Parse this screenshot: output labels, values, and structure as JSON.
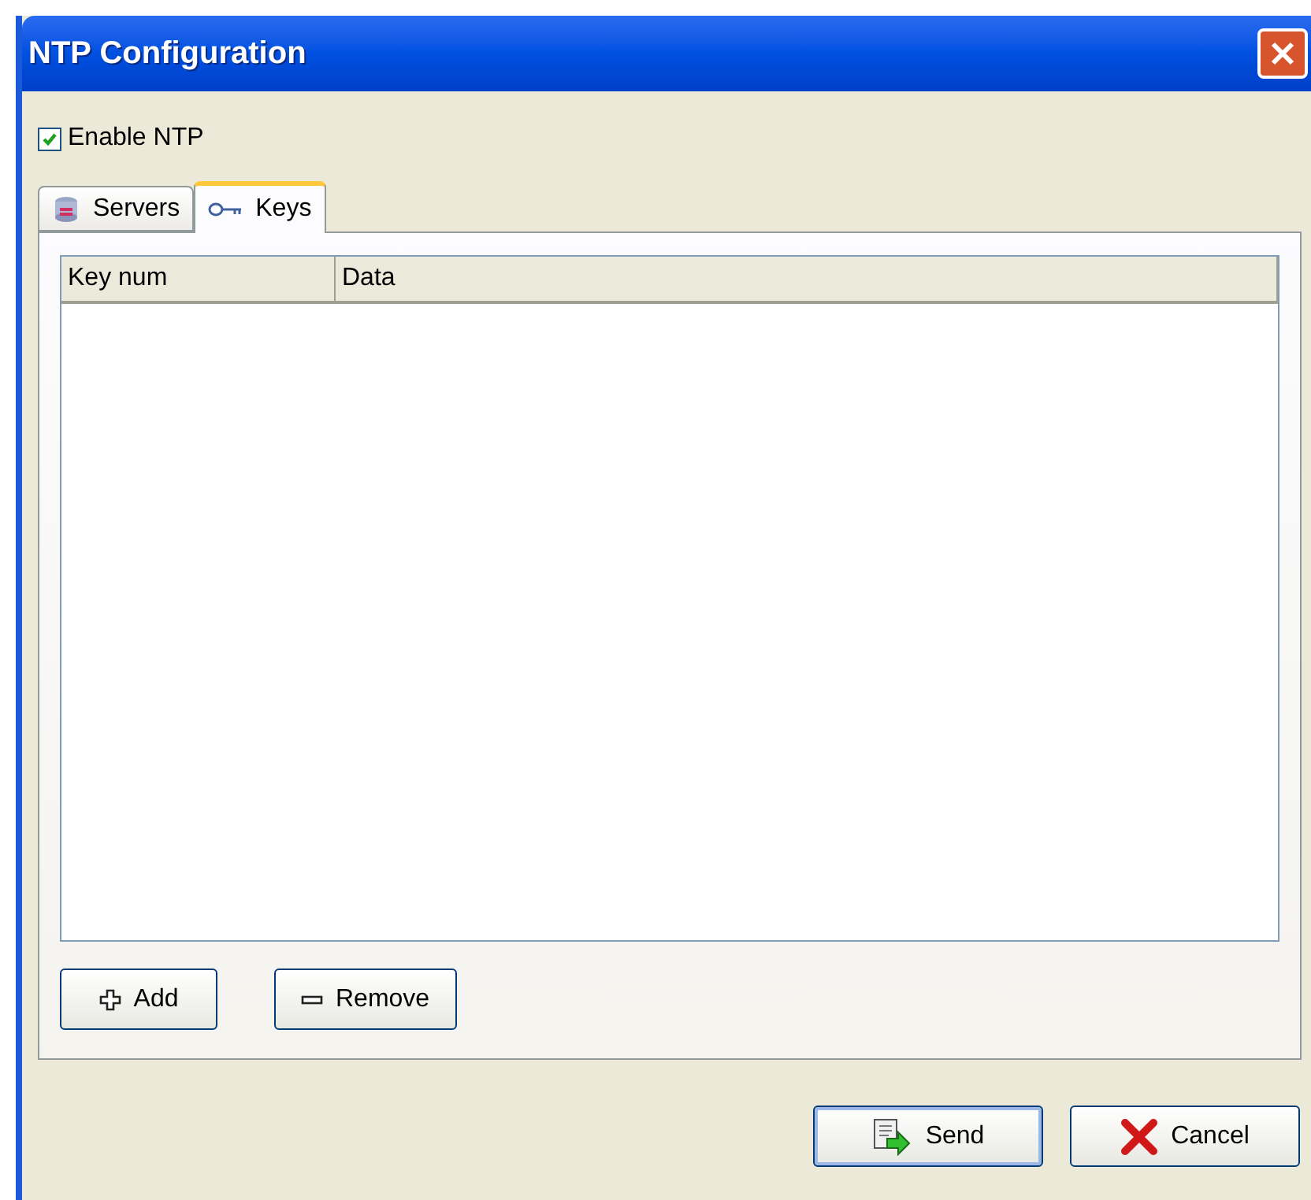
{
  "window": {
    "title": "NTP Configuration"
  },
  "enable": {
    "label": "Enable NTP",
    "checked": true
  },
  "tabs": [
    {
      "label": "Servers",
      "kind": "servers",
      "selected": false
    },
    {
      "label": "Keys",
      "kind": "keys",
      "selected": true
    }
  ],
  "table": {
    "columns": [
      "Key num",
      "Data"
    ]
  },
  "list_buttons": [
    {
      "label": "Add",
      "kind": "add"
    },
    {
      "label": "Remove",
      "kind": "remove"
    }
  ],
  "buttons": [
    {
      "label": "Send",
      "kind": "send"
    },
    {
      "label": "Cancel",
      "kind": "cancel"
    }
  ]
}
